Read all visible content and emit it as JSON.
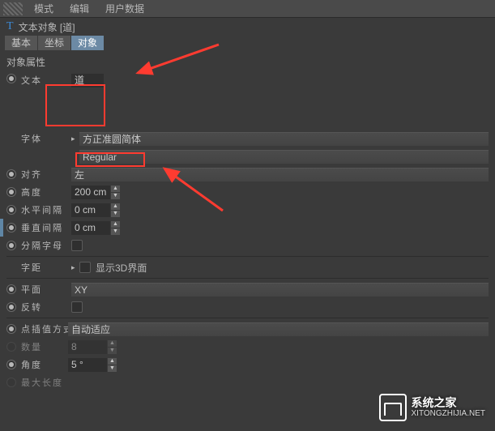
{
  "menubar": {
    "mode": "模式",
    "edit": "编辑",
    "userdata": "用户数据"
  },
  "header": {
    "title": "文本对象  [道]"
  },
  "tabs": {
    "basic": "基本",
    "coord": "坐标",
    "object": "对象"
  },
  "section": {
    "attrs": "对象属性"
  },
  "labels": {
    "text": "文本",
    "font": "字体",
    "align": "对齐",
    "height": "高度",
    "hspacing": "水平间隔",
    "vspacing": "垂直间隔",
    "sepletters": "分隔字母",
    "kerning": "字距",
    "plane": "平面",
    "invert": "反转",
    "interp": "点插值方式",
    "count": "数量",
    "angle": "角度",
    "maxlen": "最大长度"
  },
  "values": {
    "text": "道",
    "font_family": "方正准圆简体",
    "font_weight": "Regular",
    "align": "左",
    "height": "200 cm",
    "hspacing": "0 cm",
    "vspacing": "0 cm",
    "kerning_extra": "显示3D界面",
    "plane": "XY",
    "interp": "自动适应",
    "count": "8",
    "angle": "5 °"
  },
  "watermark": {
    "line1": "系统之家",
    "line2": "XITONGZHIJIA.NET"
  }
}
